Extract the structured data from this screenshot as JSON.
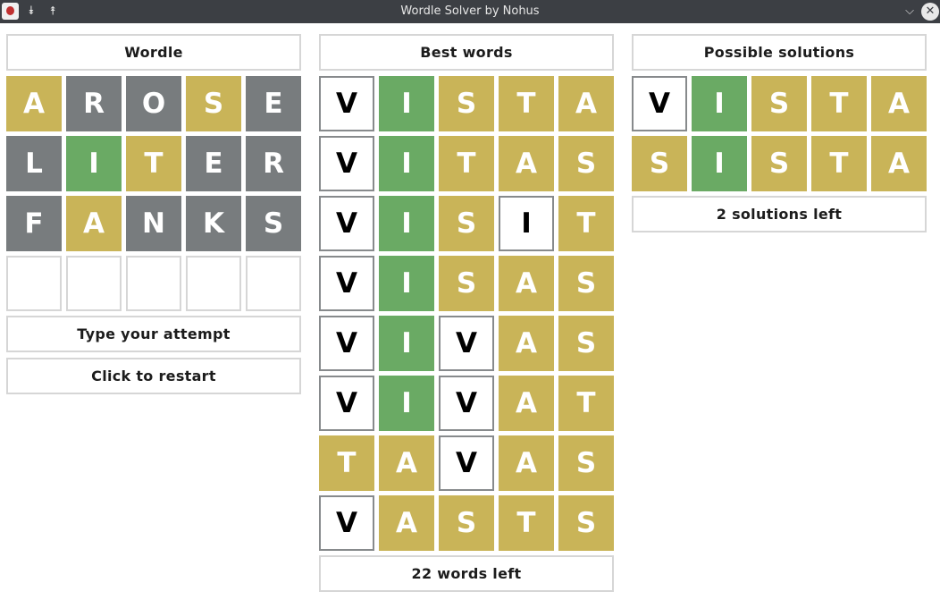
{
  "window": {
    "title": "Wordle Solver by Nohus",
    "icons": {
      "app": "app-icon",
      "minimize": "double-chevron-down-icon",
      "maximize": "double-chevron-up-icon",
      "menu": "chevron-down-icon",
      "close": "close-icon"
    }
  },
  "colors": {
    "present": "#c9b458",
    "absent": "#787c7e",
    "correct": "#6aaa64",
    "none": "#ffffff",
    "border": "#d6d6d6",
    "titlebar": "#3c3f44"
  },
  "wordle": {
    "header": "Wordle",
    "rows": [
      [
        {
          "l": "A",
          "s": "present"
        },
        {
          "l": "R",
          "s": "absent"
        },
        {
          "l": "O",
          "s": "absent"
        },
        {
          "l": "S",
          "s": "present"
        },
        {
          "l": "E",
          "s": "absent"
        }
      ],
      [
        {
          "l": "L",
          "s": "absent"
        },
        {
          "l": "I",
          "s": "correct"
        },
        {
          "l": "T",
          "s": "present"
        },
        {
          "l": "E",
          "s": "absent"
        },
        {
          "l": "R",
          "s": "absent"
        }
      ],
      [
        {
          "l": "F",
          "s": "absent"
        },
        {
          "l": "A",
          "s": "present"
        },
        {
          "l": "N",
          "s": "absent"
        },
        {
          "l": "K",
          "s": "absent"
        },
        {
          "l": "S",
          "s": "absent"
        }
      ],
      [
        {
          "l": "",
          "s": "empty"
        },
        {
          "l": "",
          "s": "empty"
        },
        {
          "l": "",
          "s": "empty"
        },
        {
          "l": "",
          "s": "empty"
        },
        {
          "l": "",
          "s": "empty"
        }
      ]
    ],
    "type_attempt_label": "Type your attempt",
    "restart_label": "Click to restart"
  },
  "best_words": {
    "header": "Best words",
    "rows": [
      [
        {
          "l": "V",
          "s": "none"
        },
        {
          "l": "I",
          "s": "correct"
        },
        {
          "l": "S",
          "s": "present"
        },
        {
          "l": "T",
          "s": "present"
        },
        {
          "l": "A",
          "s": "present"
        }
      ],
      [
        {
          "l": "V",
          "s": "none"
        },
        {
          "l": "I",
          "s": "correct"
        },
        {
          "l": "T",
          "s": "present"
        },
        {
          "l": "A",
          "s": "present"
        },
        {
          "l": "S",
          "s": "present"
        }
      ],
      [
        {
          "l": "V",
          "s": "none"
        },
        {
          "l": "I",
          "s": "correct"
        },
        {
          "l": "S",
          "s": "present"
        },
        {
          "l": "I",
          "s": "none"
        },
        {
          "l": "T",
          "s": "present"
        }
      ],
      [
        {
          "l": "V",
          "s": "none"
        },
        {
          "l": "I",
          "s": "correct"
        },
        {
          "l": "S",
          "s": "present"
        },
        {
          "l": "A",
          "s": "present"
        },
        {
          "l": "S",
          "s": "present"
        }
      ],
      [
        {
          "l": "V",
          "s": "none"
        },
        {
          "l": "I",
          "s": "correct"
        },
        {
          "l": "V",
          "s": "none"
        },
        {
          "l": "A",
          "s": "present"
        },
        {
          "l": "S",
          "s": "present"
        }
      ],
      [
        {
          "l": "V",
          "s": "none"
        },
        {
          "l": "I",
          "s": "correct"
        },
        {
          "l": "V",
          "s": "none"
        },
        {
          "l": "A",
          "s": "present"
        },
        {
          "l": "T",
          "s": "present"
        }
      ],
      [
        {
          "l": "T",
          "s": "present"
        },
        {
          "l": "A",
          "s": "present"
        },
        {
          "l": "V",
          "s": "none"
        },
        {
          "l": "A",
          "s": "present"
        },
        {
          "l": "S",
          "s": "present"
        }
      ],
      [
        {
          "l": "V",
          "s": "none"
        },
        {
          "l": "A",
          "s": "present"
        },
        {
          "l": "S",
          "s": "present"
        },
        {
          "l": "T",
          "s": "present"
        },
        {
          "l": "S",
          "s": "present"
        }
      ]
    ],
    "footer": "22 words left"
  },
  "possible_solutions": {
    "header": "Possible solutions",
    "rows": [
      [
        {
          "l": "V",
          "s": "none"
        },
        {
          "l": "I",
          "s": "correct"
        },
        {
          "l": "S",
          "s": "present"
        },
        {
          "l": "T",
          "s": "present"
        },
        {
          "l": "A",
          "s": "present"
        }
      ],
      [
        {
          "l": "S",
          "s": "present"
        },
        {
          "l": "I",
          "s": "correct"
        },
        {
          "l": "S",
          "s": "present"
        },
        {
          "l": "T",
          "s": "present"
        },
        {
          "l": "A",
          "s": "present"
        }
      ]
    ],
    "footer": "2 solutions left"
  }
}
